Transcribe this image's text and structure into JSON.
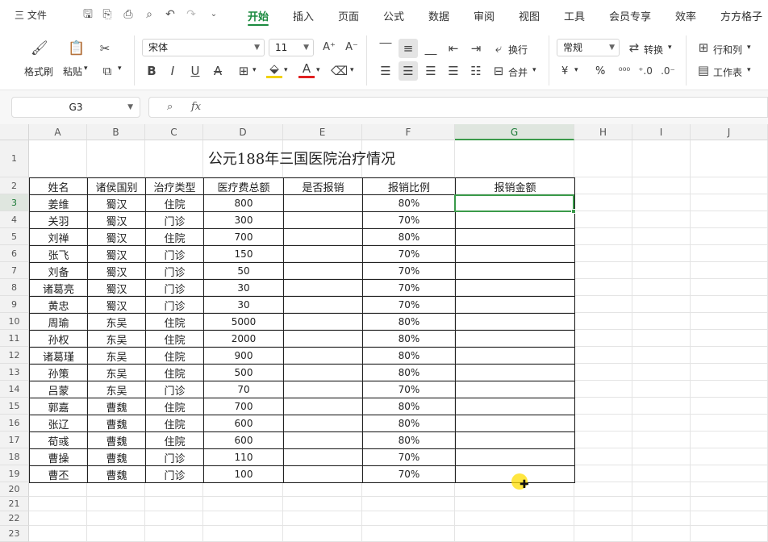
{
  "menu": {
    "file_label": "三 文件",
    "tabs": [
      "开始",
      "插入",
      "页面",
      "公式",
      "数据",
      "审阅",
      "视图",
      "工具",
      "会员专享",
      "效率",
      "方方格子"
    ],
    "active_tab": "开始"
  },
  "ribbon": {
    "format_painter": "格式刷",
    "paste": "粘贴",
    "font_name": "宋体",
    "font_size": "11",
    "wrap": "换行",
    "merge": "合并",
    "number_format": "常规",
    "convert": "转换",
    "row_col": "行和列",
    "worksheet": "工作表",
    "currency_symbol": "¥",
    "percent_symbol": "%"
  },
  "formula_bar": {
    "name_box": "G3",
    "fx": "fx",
    "formula": ""
  },
  "sheet": {
    "columns": [
      "A",
      "B",
      "C",
      "D",
      "E",
      "F",
      "G",
      "H",
      "I",
      "J"
    ],
    "rows": [
      "1",
      "2",
      "3",
      "4",
      "5",
      "6",
      "7",
      "8",
      "9",
      "10",
      "11",
      "12",
      "13",
      "14",
      "15",
      "16",
      "17",
      "18",
      "19",
      "20",
      "21",
      "22",
      "23"
    ],
    "title": "公元188年三国医院治疗情况",
    "headers": [
      "姓名",
      "诸侯国别",
      "治疗类型",
      "医疗费总额",
      "是否报销",
      "报销比例",
      "报销金额"
    ],
    "records": [
      [
        "姜维",
        "蜀汉",
        "住院",
        "800",
        "",
        "80%",
        ""
      ],
      [
        "关羽",
        "蜀汉",
        "门诊",
        "300",
        "",
        "70%",
        ""
      ],
      [
        "刘禅",
        "蜀汉",
        "住院",
        "700",
        "",
        "80%",
        ""
      ],
      [
        "张飞",
        "蜀汉",
        "门诊",
        "150",
        "",
        "70%",
        ""
      ],
      [
        "刘备",
        "蜀汉",
        "门诊",
        "50",
        "",
        "70%",
        ""
      ],
      [
        "诸葛亮",
        "蜀汉",
        "门诊",
        "30",
        "",
        "70%",
        ""
      ],
      [
        "黄忠",
        "蜀汉",
        "门诊",
        "30",
        "",
        "70%",
        ""
      ],
      [
        "周瑜",
        "东吴",
        "住院",
        "5000",
        "",
        "80%",
        ""
      ],
      [
        "孙权",
        "东吴",
        "住院",
        "2000",
        "",
        "80%",
        ""
      ],
      [
        "诸葛瑾",
        "东吴",
        "住院",
        "900",
        "",
        "80%",
        ""
      ],
      [
        "孙策",
        "东吴",
        "住院",
        "500",
        "",
        "80%",
        ""
      ],
      [
        "吕蒙",
        "东吴",
        "门诊",
        "70",
        "",
        "70%",
        ""
      ],
      [
        "郭嘉",
        "曹魏",
        "住院",
        "700",
        "",
        "80%",
        ""
      ],
      [
        "张辽",
        "曹魏",
        "住院",
        "600",
        "",
        "80%",
        ""
      ],
      [
        "荀彧",
        "曹魏",
        "住院",
        "600",
        "",
        "80%",
        ""
      ],
      [
        "曹操",
        "曹魏",
        "门诊",
        "110",
        "",
        "70%",
        ""
      ],
      [
        "曹丕",
        "曹魏",
        "门诊",
        "100",
        "",
        "70%",
        ""
      ]
    ],
    "selected_column": "G",
    "selected_row": "3",
    "accent_color": "#3a9a4a"
  }
}
